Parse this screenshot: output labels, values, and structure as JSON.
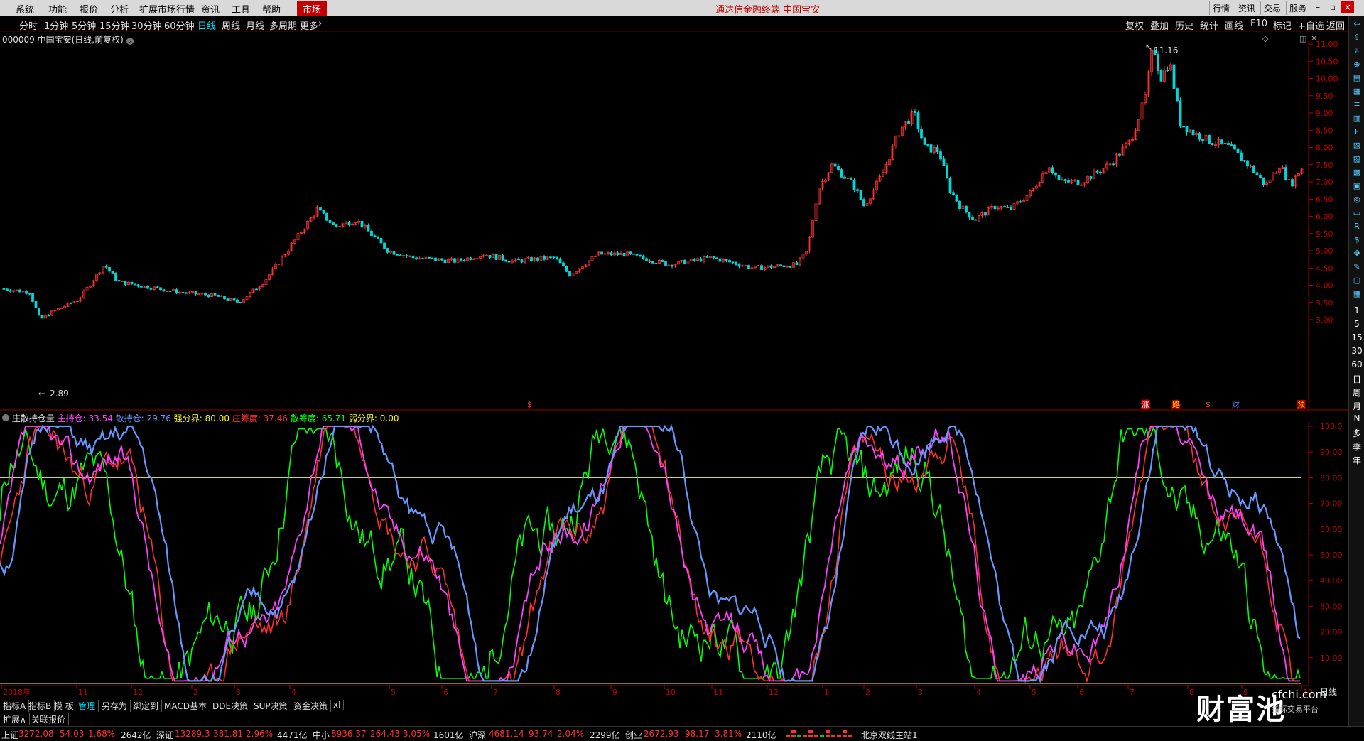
{
  "menubar": {
    "items": [
      "系统",
      "功能",
      "报价",
      "分析",
      "扩展市场行情",
      "资讯",
      "工具",
      "帮助"
    ],
    "market": "市场",
    "center_title": "通达信金融终端  中国宝安",
    "right_buttons": [
      "行情",
      "资讯",
      "交易",
      "服务"
    ]
  },
  "periods": [
    "分时",
    "1分钟",
    "5分钟",
    "15分钟",
    "30分钟",
    "60分钟",
    "日线",
    "周线",
    "月线",
    "多周期",
    "更多"
  ],
  "active_period": "日线",
  "tools": [
    "复权",
    "叠加",
    "历史",
    "统计",
    "画线",
    "F10",
    "标记",
    "+自选",
    "返回"
  ],
  "stock_title": "000009 中国宝安(日线,前复权)",
  "price_chart": {
    "high_label": "11.16",
    "low_label": "2.89",
    "y_ticks": [
      "11.00",
      "10.50",
      "10.00",
      "9.50",
      "9.00",
      "8.50",
      "8.00",
      "7.50",
      "7.00",
      "6.50",
      "6.00",
      "5.50",
      "5.00",
      "4.50",
      "4.00",
      "3.50",
      "3.00"
    ],
    "markers": [
      "$",
      "涨",
      "路",
      "$",
      "财",
      "预"
    ]
  },
  "indicator": {
    "name": "庄散持仓量",
    "items": [
      {
        "label": "主持仓: 33.54",
        "color": "#ff40ff"
      },
      {
        "label": "散持仓: 29.76",
        "color": "#6699ff"
      },
      {
        "label": "强分界: 80.00",
        "color": "#ffff00"
      },
      {
        "label": "庄筹度: 37.46",
        "color": "#ff3030"
      },
      {
        "label": "散筹度: 65.71",
        "color": "#00ff00"
      },
      {
        "label": "弱分界: 0.00",
        "color": "#ffff00"
      }
    ],
    "y_ticks": [
      "100.0",
      "90.00",
      "80.00",
      "70.00",
      "60.00",
      "50.00",
      "40.00",
      "30.00",
      "20.00",
      "10.00"
    ]
  },
  "x_axis": [
    "2018年",
    "11",
    "12",
    "2",
    "3",
    "4",
    "5",
    "6",
    "7",
    "8",
    "9",
    "10",
    "11",
    "12",
    "1",
    "2",
    "3",
    "4",
    "5",
    "6",
    "7",
    "8",
    "9",
    "10"
  ],
  "x_axis_right": "日线",
  "tabs1": [
    "指标A",
    "指标B",
    "模 板",
    "管理",
    "另存为",
    "绑定到",
    "MACD基本",
    "DDE决策",
    "SUP决策",
    "资金决策",
    "xl"
  ],
  "active_tab": "管理",
  "tabs2": [
    "扩展∧",
    "关联报价"
  ],
  "status": [
    {
      "name": "上证",
      "value": "3272.08",
      "chg": "54.03",
      "pct": "1.68%",
      "amt": "2642亿"
    },
    {
      "name": "深证",
      "value": "13289.3",
      "chg": "381.81",
      "pct": "2.96%",
      "amt": "4471亿"
    },
    {
      "name": "中小",
      "value": "8936.37",
      "chg": "264.43",
      "pct": "3.05%",
      "amt": "1601亿"
    },
    {
      "name": "沪深",
      "value": "4681.14",
      "chg": "93.74",
      "pct": "2.04%",
      "amt": "2299亿"
    },
    {
      "name": "创业",
      "value": "2672.93",
      "chg": "98.17",
      "pct": "3.81%",
      "amt": "2110亿"
    }
  ],
  "server": "北京双线主站1",
  "right_tools_text": [
    "1",
    "5",
    "15",
    "30",
    "60",
    "日",
    "周",
    "月",
    "N",
    "多",
    "季",
    "年"
  ],
  "logo": {
    "main": "财富池",
    "sub": "cfchi.com",
    "sub2": "指标交易平台"
  },
  "colors": {
    "up": "#ff3030",
    "down": "#00d8d8",
    "zhu": "#ff40ff",
    "san": "#6699ff",
    "zhuang": "#ff3030",
    "sandu": "#00ff00",
    "line": "#ffff00"
  }
}
